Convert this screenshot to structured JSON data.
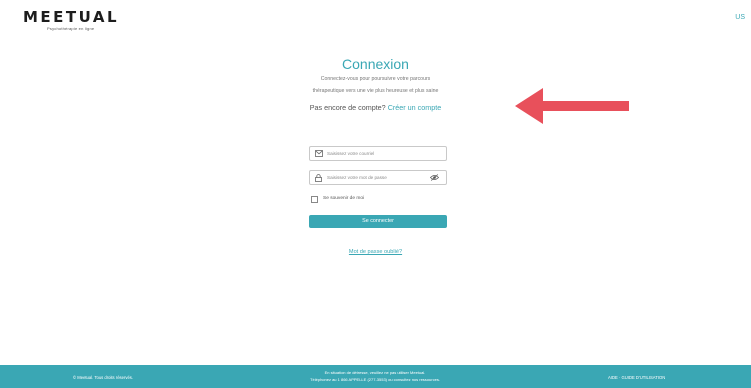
{
  "header": {
    "logo_text": "MEETUAL",
    "logo_tagline": "Psychothérapie en ligne",
    "language": "US"
  },
  "login": {
    "title": "Connexion",
    "description_line1": "Connectez-vous pour poursuivre votre parcours",
    "description_line2": "thérapeutique vers une vie plus heureuse et plus saine",
    "signup_prompt": "Pas encore de compte?",
    "signup_link": "Créer un compte",
    "email_placeholder": "Saisissez votre courriel",
    "password_placeholder": "Saisissez votre mot de passe",
    "remember_label": "Se souvenir de moi",
    "remember_checked": false,
    "submit_label": "Se connecter",
    "forgot_link": "Mot de passe oublié?"
  },
  "annotation": {
    "arrow_color": "#e8505b"
  },
  "footer": {
    "copyright": "© Meetual. Tous droits réservés.",
    "notice_line1": "En situation de détresse, veuillez ne pas utiliser Meetual.",
    "notice_line2": "Téléphonez au 1 866 APPELLE (277-3553) ou consultez nos ressources.",
    "links": "AIDE · GUIDE D'UTILISATION"
  },
  "colors": {
    "accent": "#3aa7b4"
  }
}
